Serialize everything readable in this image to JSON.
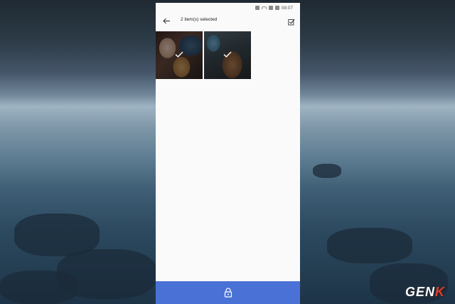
{
  "status_bar": {
    "time": "08:07"
  },
  "app_bar": {
    "title": "2 item(s) selected",
    "back_icon": "arrow-left-icon",
    "select_all_icon": "checklist-icon"
  },
  "photos": [
    {
      "name": "photo-1",
      "selected": true
    },
    {
      "name": "photo-2",
      "selected": true
    }
  ],
  "bottom_bar": {
    "action_icon": "lock-icon",
    "color": "#4a72d6"
  },
  "watermark": {
    "text_main": "GEN",
    "text_accent": "K"
  }
}
